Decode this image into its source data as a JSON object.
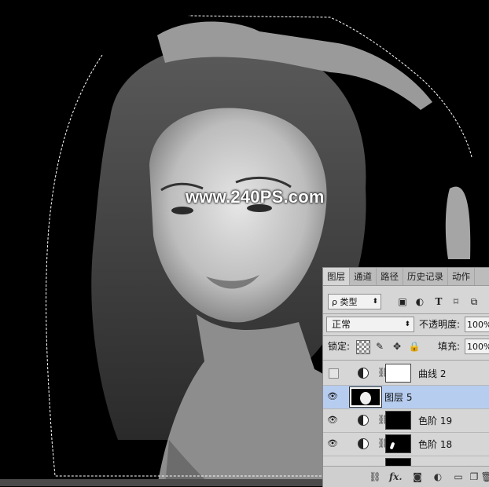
{
  "watermark": "www.240PS.com",
  "layers_panel": {
    "tabs": [
      "图层",
      "通道",
      "路径",
      "历史记录",
      "动作"
    ],
    "filter": {
      "label": "ρ 类型",
      "icons": [
        "image-filter-icon",
        "adjustment-filter-icon",
        "type-filter-icon",
        "shape-filter-icon",
        "smart-object-filter-icon"
      ]
    },
    "blend_mode": "正常",
    "opacity": {
      "label": "不透明度:",
      "value": "100%"
    },
    "lock": {
      "label": "锁定:",
      "icons": [
        "lock-transparent-icon",
        "lock-image-icon",
        "lock-position-icon",
        "lock-all-icon"
      ]
    },
    "fill": {
      "label": "填充:",
      "value": "100%"
    },
    "layers": [
      {
        "name": "曲线 2",
        "visible": false,
        "kind": "curves",
        "selected": false
      },
      {
        "name": "图层 5",
        "visible": true,
        "kind": "pixel",
        "selected": true
      },
      {
        "name": "色阶 19",
        "visible": true,
        "kind": "levels",
        "selected": false
      },
      {
        "name": "色阶 18",
        "visible": true,
        "kind": "levels",
        "selected": false
      }
    ],
    "bottom_icons": [
      "link-layers-icon",
      "fx-icon",
      "add-mask-icon",
      "new-adjustment-icon",
      "new-group-icon",
      "new-layer-icon",
      "delete-layer-icon"
    ],
    "fx_label": "fx."
  }
}
